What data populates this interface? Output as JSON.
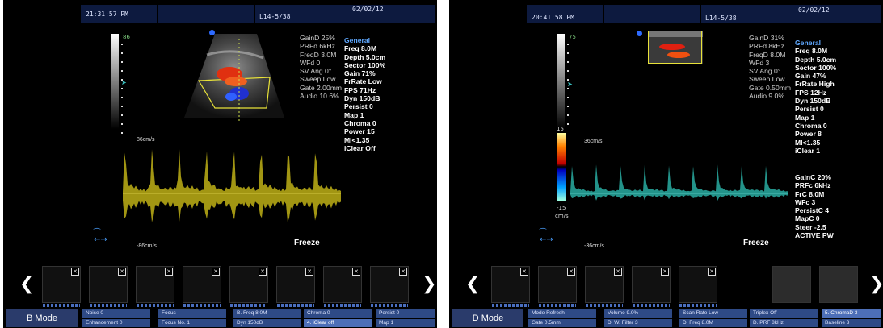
{
  "left": {
    "header": {
      "time": "21:31:57 PM",
      "probe": "L14-5/38",
      "date": "02/02/12"
    },
    "scale_top": "86",
    "doppler_params": [
      "GainD 25%",
      "PRFd 6kHz",
      "FreqD 3.0M",
      "WFd 0",
      "SV Ang 0°",
      "Sweep Low",
      "Gate 2.00mm",
      "Audio 10.6%"
    ],
    "general": [
      "General",
      "Freq 8.0M",
      "Depth 5.0cm",
      "Sector 100%",
      "Gain 71%",
      "FrRate Low",
      "FPS 71Hz",
      "Dyn 150dB",
      "Persist 0",
      "Map 1",
      "Chroma 0",
      "Power 15",
      "MI<1.35",
      "iClear Off"
    ],
    "spectrum": {
      "top_label": "86cm/s",
      "bottom_label": "-86cm/s",
      "color": "#d8c81a"
    },
    "freeze": "Freeze",
    "mode": "B Mode",
    "bottom_row1": [
      "Noise 0",
      "Focus",
      "B. Freq 8.0M",
      "Chroma 0",
      "Persist 0"
    ],
    "bottom_row2": [
      "Enhancement 0",
      "Focus No. 1",
      "Dyn 150dB",
      "4. iClear off",
      "Map 1"
    ]
  },
  "right": {
    "header": {
      "time": "20:41:58 PM",
      "probe": "L14-5/38",
      "date": "02/02/12"
    },
    "scale_top": "75",
    "doppler_params": [
      "GainD 31%",
      "PRFd 8kHz",
      "FreqD 8.0M",
      "WFd 3",
      "SV Ang 0°",
      "Sweep Low",
      "Gate 0.50mm",
      "Audio 9.0%"
    ],
    "general": [
      "General",
      "Freq 8.0M",
      "Depth 5.0cm",
      "Sector 100%",
      "Gain 47%",
      "FrRate High",
      "FPS 12Hz",
      "Dyn 150dB",
      "Persist 0",
      "Map 1",
      "Chroma 0",
      "Power 8",
      "MI<1.35",
      "iClear 1"
    ],
    "color_params": [
      "GainC 20%",
      "PRFc 6kHz",
      "FrC 8.0M",
      "WFc 3",
      "PersistC 4",
      "MapC 0",
      "Steer -2.5",
      "ACTIVE PW"
    ],
    "colorbar": {
      "top": "15",
      "bottom": "-15",
      "unit": "cm/s"
    },
    "spectrum": {
      "top_label": "36cm/s",
      "bottom_label": "-36cm/s",
      "color": "#2fc4b8"
    },
    "freeze": "Freeze",
    "mode": "D Mode",
    "bottom_row1": [
      "Mode Refresh",
      "Volume 9.0%",
      "Scan Rate Low",
      "Triplex Off",
      "5. ChromaD 3"
    ],
    "bottom_row2": [
      "Gate 0.5mm",
      "D. W. Filter 3",
      "D. Freq 8.0M",
      "D. PRF 8kHz",
      "Baseline 3"
    ]
  }
}
